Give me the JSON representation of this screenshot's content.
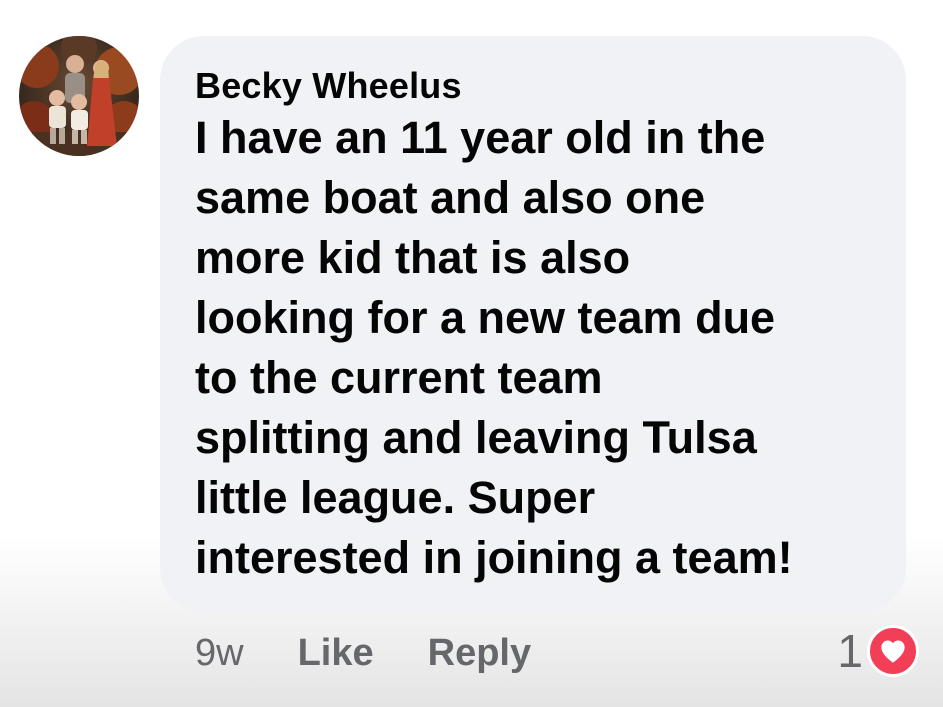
{
  "comment": {
    "author": "Becky Wheelus",
    "text": "I have an 11 year old in the\nsame boat and also one\nmore kid that is also\nlooking for a new team due\nto the current team\nsplitting and leaving Tulsa\nlittle league. Super\ninterested in joining a team!",
    "timestamp": "9w",
    "like_label": "Like",
    "reply_label": "Reply",
    "reaction_count": "1",
    "reaction_icon": "heart-icon",
    "avatar_icon": "profile-photo"
  },
  "colors": {
    "bubble": "#f0f2f5",
    "text": "#050505",
    "secondary_text": "#65676b",
    "heart": "#f33e58"
  }
}
